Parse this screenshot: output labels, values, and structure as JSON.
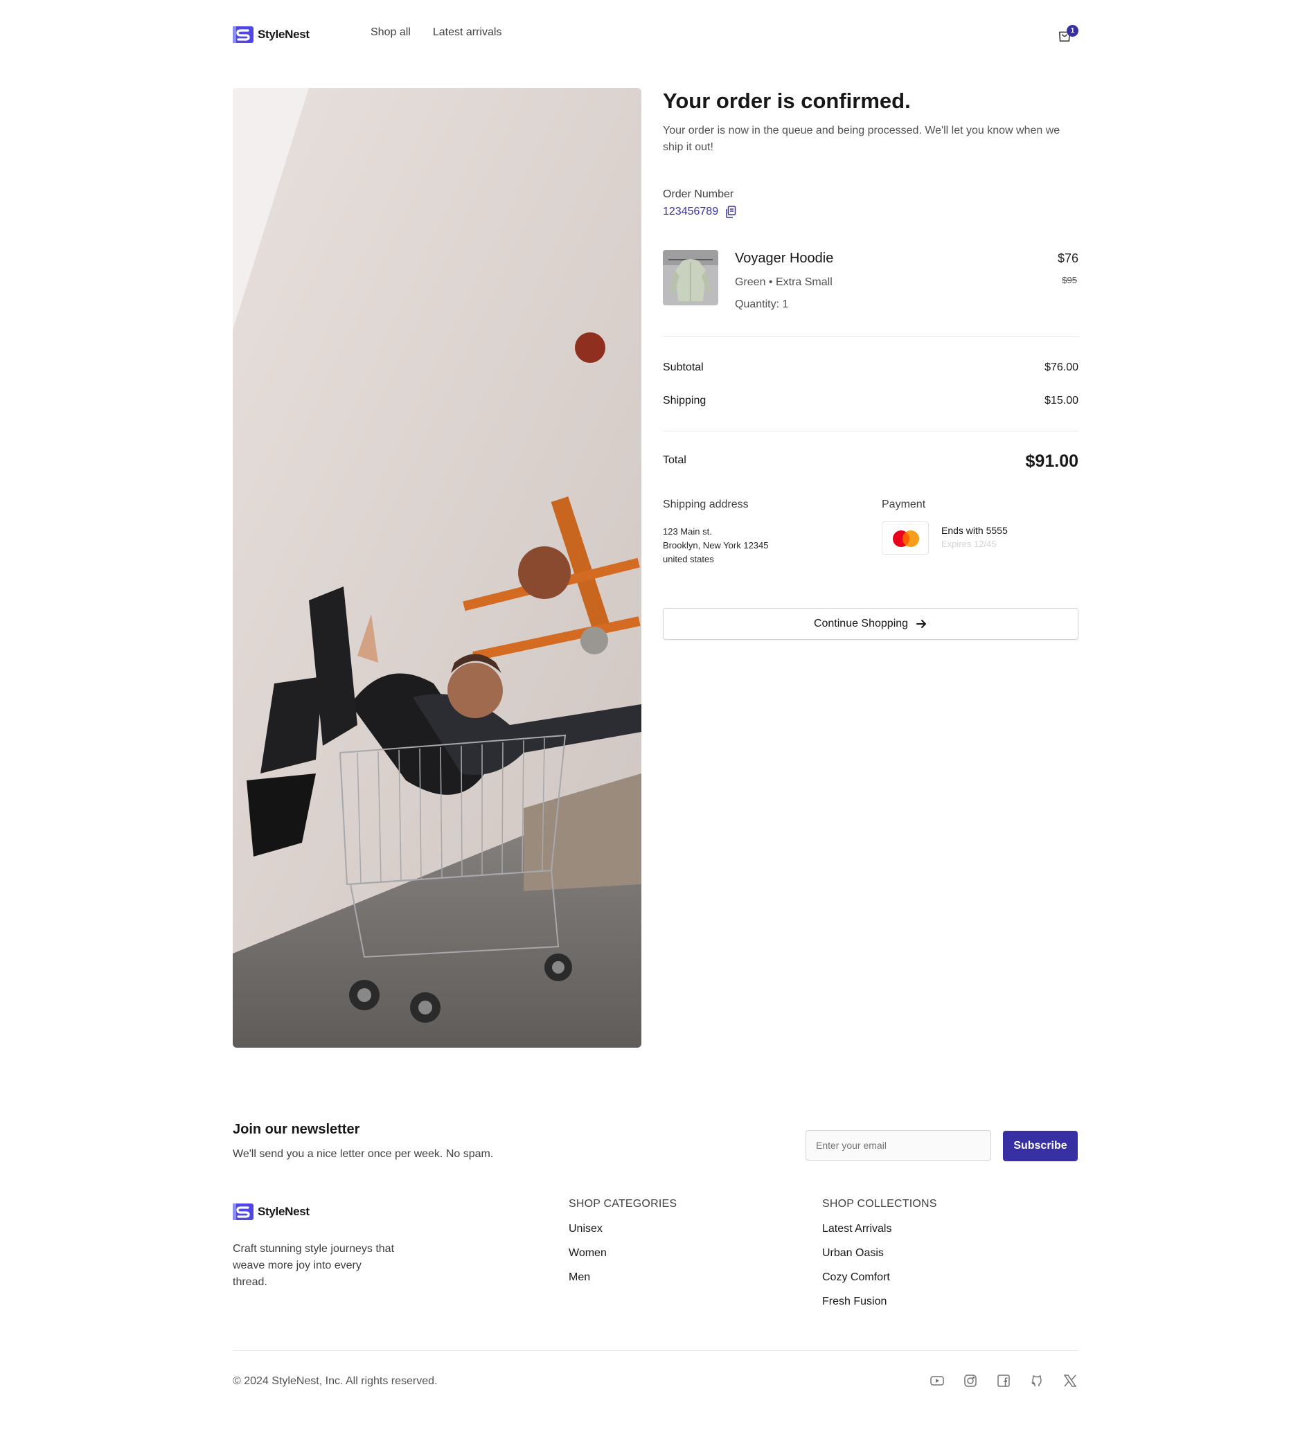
{
  "brand": {
    "name": "StyleNest",
    "accent": "#3730a3"
  },
  "nav": {
    "items": [
      "Shop all",
      "Latest arrivals"
    ]
  },
  "cart": {
    "count": "1"
  },
  "confirmation": {
    "title": "Your order is confirmed.",
    "description": "Your order is now in the queue and being processed. We'll let you know when we ship it out!",
    "order_label": "Order Number",
    "order_number": "123456789"
  },
  "item": {
    "name": "Voyager Hoodie",
    "variant": "Green • Extra Small",
    "quantity": "Quantity: 1",
    "price": "$76",
    "original_price": "$95"
  },
  "summary": {
    "subtotal_label": "Subtotal",
    "subtotal": "$76.00",
    "shipping_label": "Shipping",
    "shipping": "$15.00",
    "total_label": "Total",
    "total": "$91.00"
  },
  "shipping_address": {
    "label": "Shipping address",
    "lines": [
      "123 Main st.",
      "Brooklyn, New York 12345",
      "united states"
    ]
  },
  "payment": {
    "label": "Payment",
    "card_icon": "mastercard-icon",
    "ends": "Ends with 5555",
    "expires": "Expires 12/45"
  },
  "continue_label": "Continue Shopping",
  "newsletter": {
    "title": "Join our newsletter",
    "description": "We'll send you a nice letter once per week. No spam.",
    "placeholder": "Enter your email",
    "button": "Subscribe"
  },
  "footer": {
    "tagline": "Craft stunning style journeys that weave more joy into every thread.",
    "categories": {
      "heading": "SHOP CATEGORIES",
      "items": [
        "Unisex",
        "Women",
        "Men"
      ]
    },
    "collections": {
      "heading": "SHOP COLLECTIONS",
      "items": [
        "Latest Arrivals",
        "Urban Oasis",
        "Cozy Comfort",
        "Fresh Fusion"
      ]
    },
    "copyright": "© 2024 StyleNest, Inc. All rights reserved.",
    "socials": [
      "youtube-icon",
      "instagram-icon",
      "facebook-icon",
      "github-icon",
      "x-icon"
    ]
  }
}
